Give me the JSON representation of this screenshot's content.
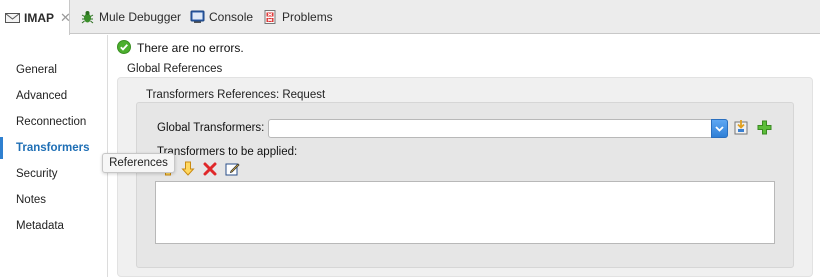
{
  "tabs": [
    {
      "label": "IMAP",
      "icon": "mail-connector-icon",
      "active": true
    },
    {
      "label": "Mule Debugger",
      "icon": "bug-icon"
    },
    {
      "label": "Console",
      "icon": "console-icon"
    },
    {
      "label": "Problems",
      "icon": "problems-icon"
    }
  ],
  "tab_close": "✕",
  "sidebar": {
    "items": [
      {
        "label": "General"
      },
      {
        "label": "Advanced"
      },
      {
        "label": "Reconnection"
      },
      {
        "label": "Transformers",
        "selected": true
      },
      {
        "label": "Security"
      },
      {
        "label": "Notes"
      },
      {
        "label": "Metadata"
      }
    ]
  },
  "status": {
    "text": "There are no errors.",
    "icon": "check-circle-icon",
    "color": "#4caf2e"
  },
  "global_references": {
    "title": "Global References"
  },
  "transformers_group": {
    "title": "Transformers References: Request",
    "global_transformers_label": "Global Transformers:",
    "global_transformers_value": "",
    "to_be_applied_label": "Transformers to be applied:"
  },
  "tooltip": {
    "text": "References"
  },
  "colors": {
    "accent": "#2f80d0",
    "selected_nav": "#1f6fb5",
    "add": "#3da52a",
    "remove": "#e0282a",
    "arrow": "#f0a020"
  }
}
